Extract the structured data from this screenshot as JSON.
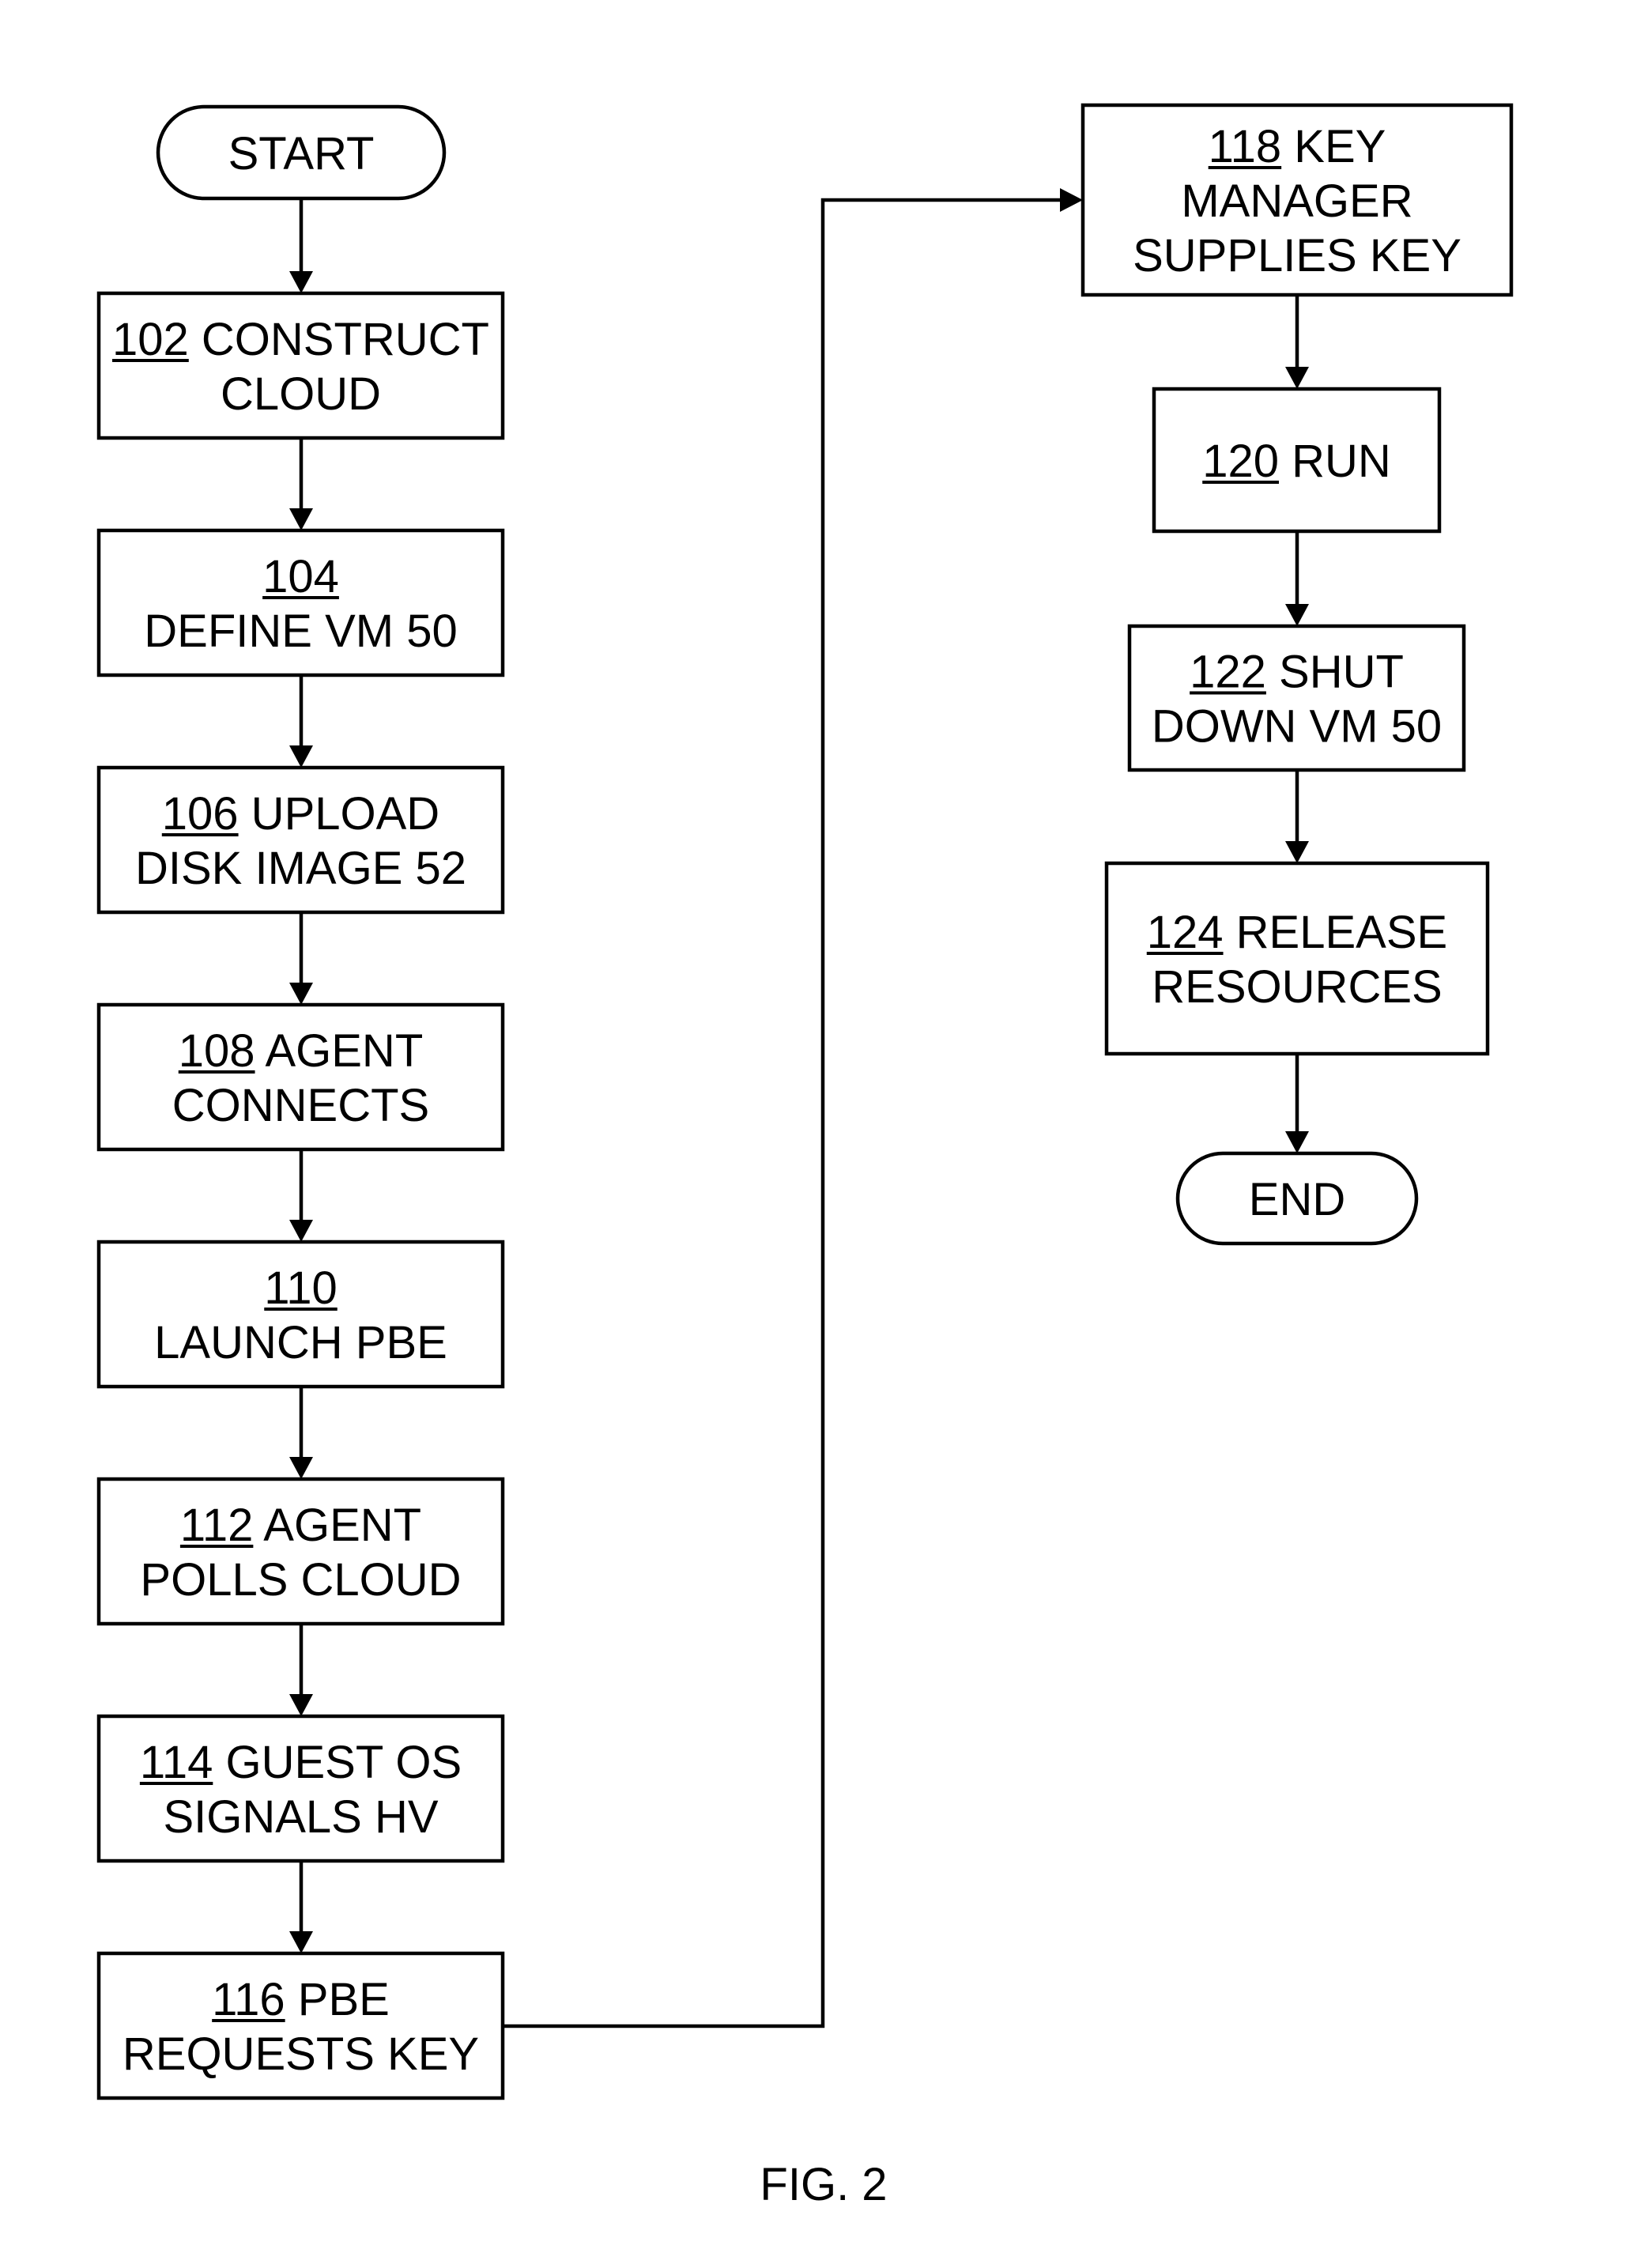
{
  "figure": {
    "caption": "FIG. 2",
    "terminals": {
      "start": "START",
      "end": "END"
    },
    "steps": [
      {
        "ref": "102",
        "lines": [
          "CONSTRUCT",
          "CLOUD"
        ],
        "layout": "inline-first"
      },
      {
        "ref": "104",
        "lines": [
          "DEFINE VM 50"
        ],
        "layout": "ref-own-line"
      },
      {
        "ref": "106",
        "lines": [
          "UPLOAD",
          "DISK IMAGE 52"
        ],
        "layout": "inline-first"
      },
      {
        "ref": "108",
        "lines": [
          "AGENT",
          "CONNECTS"
        ],
        "layout": "inline-first"
      },
      {
        "ref": "110",
        "lines": [
          "LAUNCH PBE"
        ],
        "layout": "ref-own-line"
      },
      {
        "ref": "112",
        "lines": [
          "AGENT",
          "POLLS CLOUD"
        ],
        "layout": "inline-first"
      },
      {
        "ref": "114",
        "lines": [
          "GUEST OS",
          "SIGNALS HV"
        ],
        "layout": "inline-first"
      },
      {
        "ref": "116",
        "lines": [
          "PBE",
          "REQUESTS KEY"
        ],
        "layout": "inline-first"
      },
      {
        "ref": "118",
        "lines": [
          "KEY",
          "MANAGER",
          "SUPPLIES KEY"
        ],
        "layout": "inline-first"
      },
      {
        "ref": "120",
        "lines": [
          "RUN"
        ],
        "layout": "inline-first"
      },
      {
        "ref": "122",
        "lines": [
          "SHUT",
          "DOWN VM 50"
        ],
        "layout": "inline-first"
      },
      {
        "ref": "124",
        "lines": [
          "RELEASE",
          "RESOURCES"
        ],
        "layout": "inline-first"
      }
    ],
    "flow": [
      "start",
      "102",
      "104",
      "106",
      "108",
      "110",
      "112",
      "114",
      "116",
      "118",
      "120",
      "122",
      "124",
      "end"
    ]
  }
}
